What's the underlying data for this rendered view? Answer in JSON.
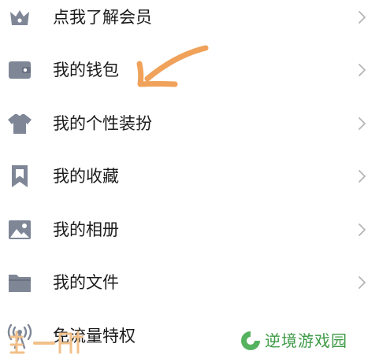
{
  "menu": {
    "items": [
      {
        "label": "点我了解会员",
        "icon": "crown-icon"
      },
      {
        "label": "我的钱包",
        "icon": "wallet-icon"
      },
      {
        "label": "我的个性装扮",
        "icon": "tshirt-icon"
      },
      {
        "label": "我的收藏",
        "icon": "bookmark-icon"
      },
      {
        "label": "我的相册",
        "icon": "image-icon"
      },
      {
        "label": "我的文件",
        "icon": "folder-icon"
      },
      {
        "label": "免流量特权",
        "icon": "signal-tower-icon"
      }
    ],
    "chevron_icon": "chevron-right-icon"
  },
  "annotation": {
    "arrow_color": "#f0a25a",
    "arrow_icon": "hand-drawn-arrow-icon"
  },
  "watermark": {
    "left_logo_icon": "watermark-logo-icon",
    "right_logo_icon": "leaf-logo-icon",
    "right_text": "逆境游戏园",
    "right_color": "#3d9a46"
  },
  "colors": {
    "icon": "#7f8797",
    "text": "#1b1b1b",
    "chevron": "#b5b5b5"
  }
}
